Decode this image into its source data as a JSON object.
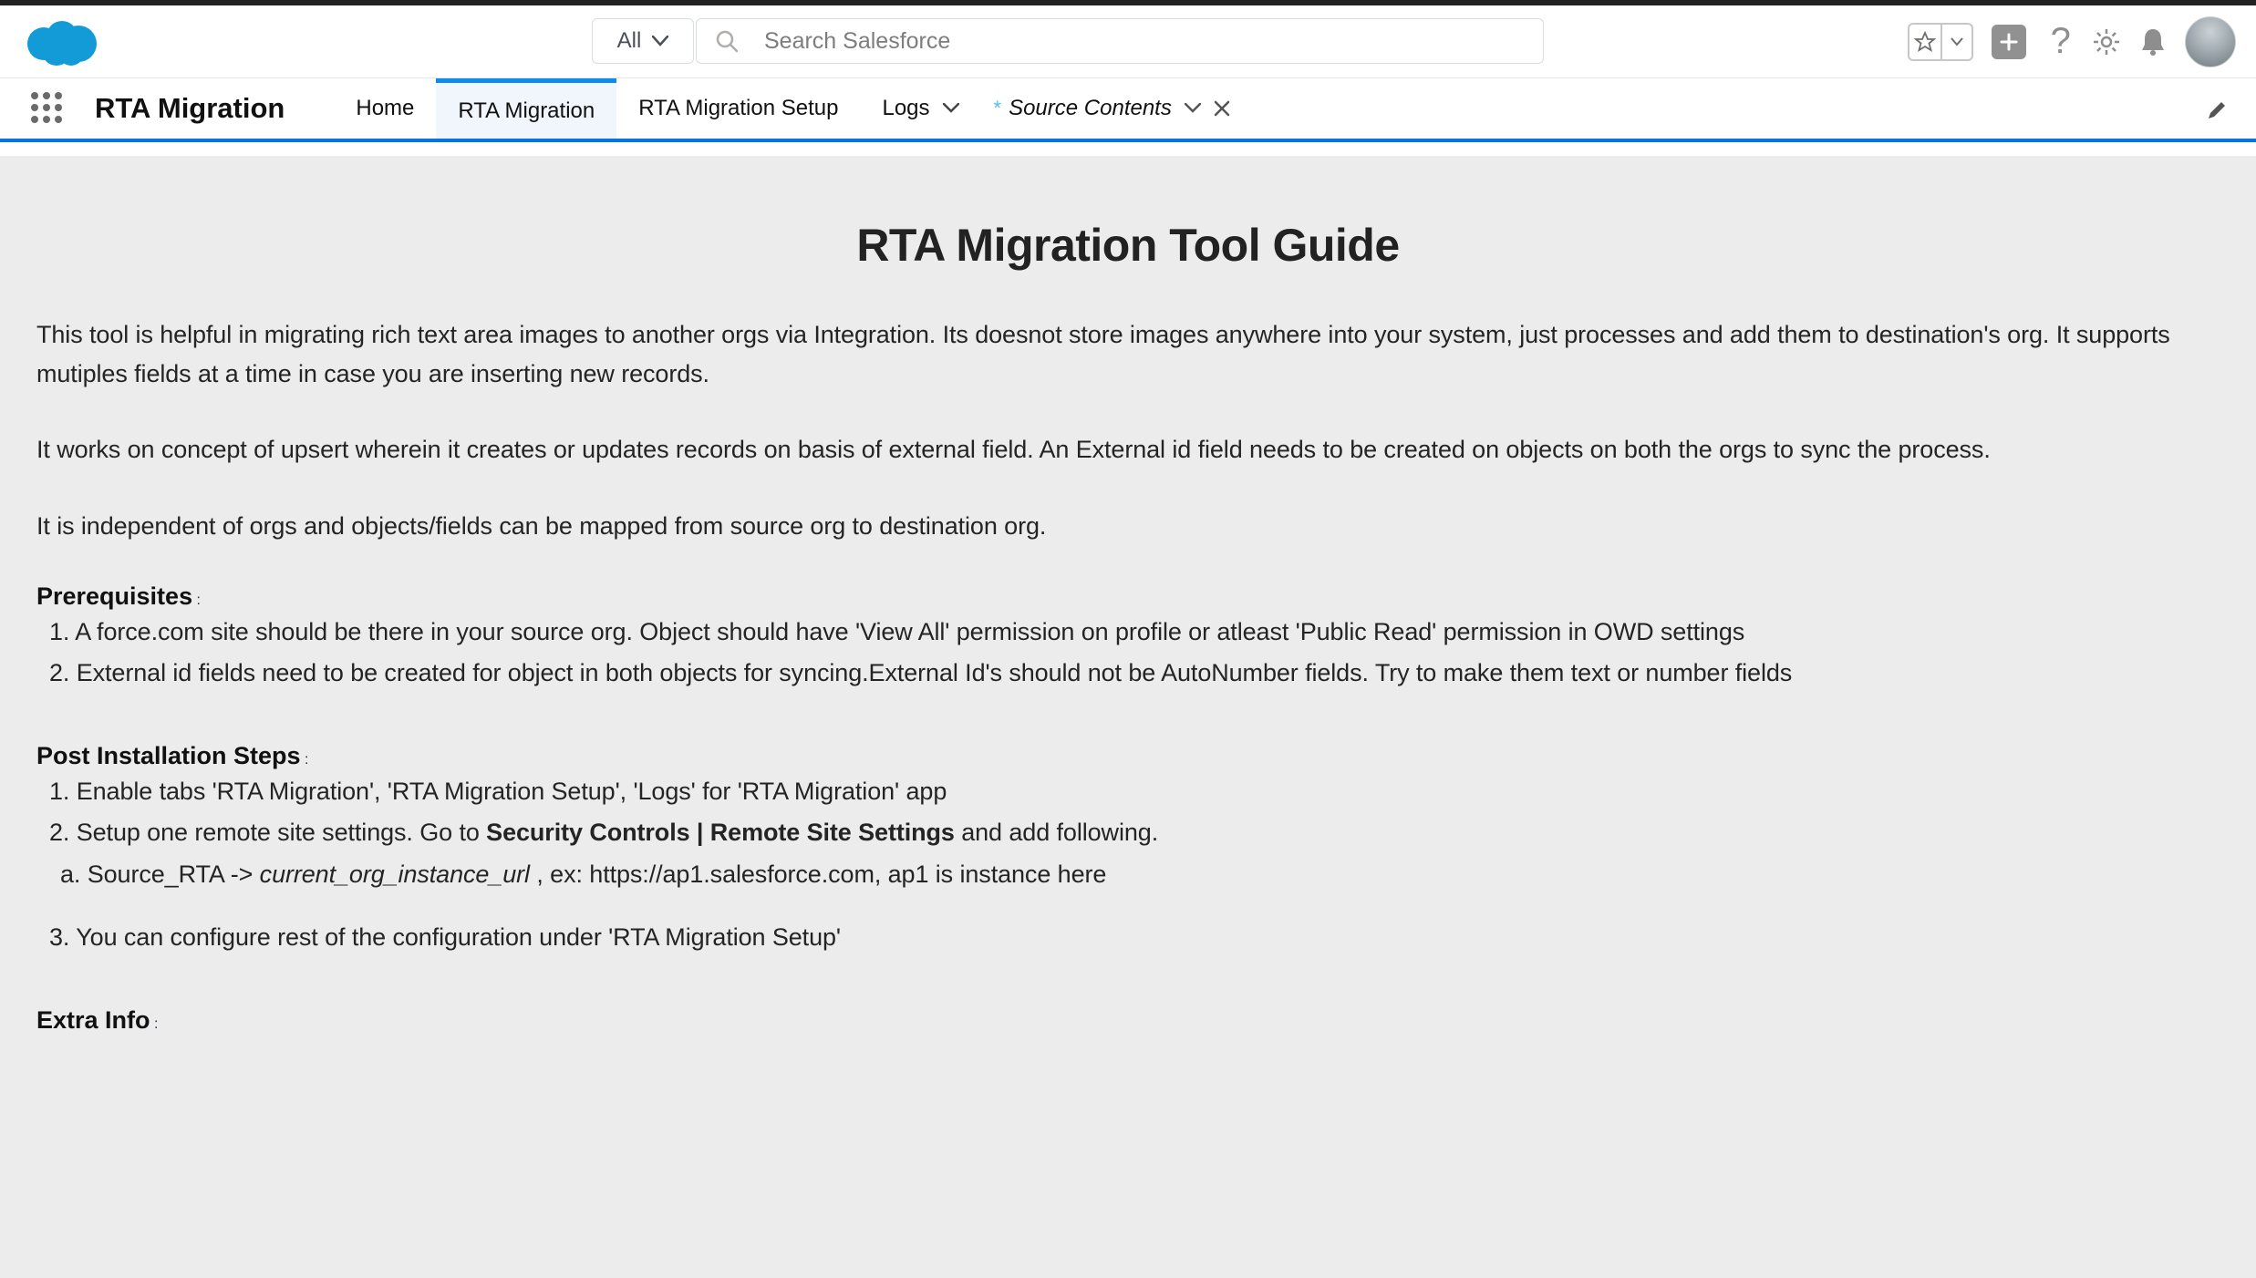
{
  "header": {
    "search_scope_label": "All",
    "search_placeholder": "Search Salesforce"
  },
  "nav": {
    "app_name": "RTA Migration",
    "tabs": {
      "home": "Home",
      "rta_migration": "RTA Migration",
      "rta_migration_setup": "RTA Migration Setup",
      "logs": "Logs",
      "source_contents": "Source Contents"
    }
  },
  "content": {
    "title": "RTA Migration Tool Guide",
    "intro_p1": "This tool is helpful in migrating rich text area images to another orgs via Integration. Its doesnot store images anywhere into your system, just processes and add them to destination's org. It supports mutiples fields at a time in case you are inserting new records.",
    "intro_p2": "It works on concept of upsert wherein it creates or updates records on basis of external field. An External id field needs to be created on objects on both the orgs to sync the process.",
    "intro_p3": "It is independent of orgs and objects/fields can be mapped from source org to destination org.",
    "prereq_heading": "Prerequisites",
    "prereq_colon": " :",
    "prereq_1": "1. A force.com site should be there in your source org. Object should have 'View All' permission on profile or atleast 'Public Read' permission in OWD settings",
    "prereq_2": "2. External id fields need to be created for object in both objects for syncing.External Id's should not be AutoNumber fields. Try to make them text or number fields",
    "post_heading": "Post Installation Steps",
    "post_colon": " :",
    "post_1": "1. Enable tabs 'RTA Migration', 'RTA Migration Setup', 'Logs' for 'RTA Migration' app",
    "post_2_pre": "2. Setup one remote site settings. Go to ",
    "post_2_bold": "Security Controls | Remote Site Settings",
    "post_2_post": " and add following.",
    "post_2a_pre": "a. Source_RTA -> ",
    "post_2a_italic": "current_org_instance_url",
    "post_2a_post": " , ex: https://ap1.salesforce.com, ap1 is instance here",
    "post_3": "3. You can configure rest of the configuration under 'RTA Migration Setup'",
    "extra_heading": "Extra Info",
    "extra_colon": " :"
  }
}
